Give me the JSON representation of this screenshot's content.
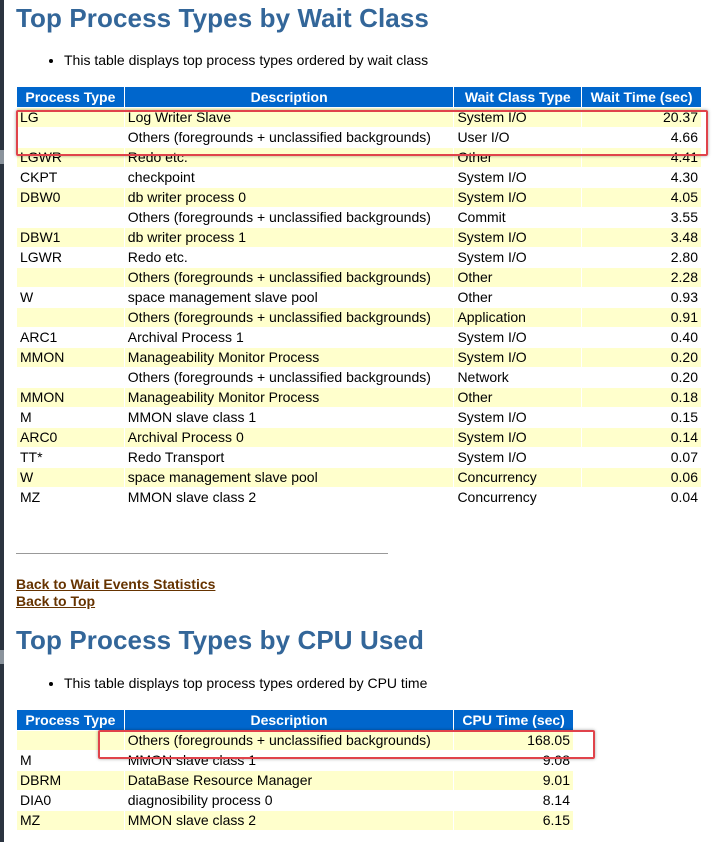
{
  "wait_section": {
    "title": "Top Process Types by Wait Class",
    "note": "This table displays top process types ordered by wait class",
    "columns": [
      "Process Type",
      "Description",
      "Wait Class Type",
      "Wait Time (sec)"
    ],
    "rows": [
      [
        "LG",
        "Log Writer Slave",
        "System I/O",
        "20.37"
      ],
      [
        "",
        "Others (foregrounds + unclassified backgrounds)",
        "User I/O",
        "4.66"
      ],
      [
        "LGWR",
        "Redo etc.",
        "Other",
        "4.41"
      ],
      [
        "CKPT",
        "checkpoint",
        "System I/O",
        "4.30"
      ],
      [
        "DBW0",
        "db writer process 0",
        "System I/O",
        "4.05"
      ],
      [
        "",
        "Others (foregrounds + unclassified backgrounds)",
        "Commit",
        "3.55"
      ],
      [
        "DBW1",
        "db writer process 1",
        "System I/O",
        "3.48"
      ],
      [
        "LGWR",
        "Redo etc.",
        "System I/O",
        "2.80"
      ],
      [
        "",
        "Others (foregrounds + unclassified backgrounds)",
        "Other",
        "2.28"
      ],
      [
        "W",
        "space management slave pool",
        "Other",
        "0.93"
      ],
      [
        "",
        "Others (foregrounds + unclassified backgrounds)",
        "Application",
        "0.91"
      ],
      [
        "ARC1",
        "Archival Process 1",
        "System I/O",
        "0.40"
      ],
      [
        "MMON",
        "Manageability Monitor Process",
        "System I/O",
        "0.20"
      ],
      [
        "",
        "Others (foregrounds + unclassified backgrounds)",
        "Network",
        "0.20"
      ],
      [
        "MMON",
        "Manageability Monitor Process",
        "Other",
        "0.18"
      ],
      [
        "M",
        "MMON slave class 1",
        "System I/O",
        "0.15"
      ],
      [
        "ARC0",
        "Archival Process 0",
        "System I/O",
        "0.14"
      ],
      [
        "TT*",
        "Redo Transport",
        "System I/O",
        "0.07"
      ],
      [
        "W",
        "space management slave pool",
        "Concurrency",
        "0.06"
      ],
      [
        "MZ",
        "MMON slave class 2",
        "Concurrency",
        "0.04"
      ]
    ]
  },
  "links": {
    "back_wait_events": "Back to Wait Events Statistics",
    "back_top": "Back to Top"
  },
  "cpu_section": {
    "title": "Top Process Types by CPU Used",
    "note": "This table displays top process types ordered by CPU time",
    "columns": [
      "Process Type",
      "Description",
      "CPU Time (sec)"
    ],
    "rows": [
      [
        "",
        "Others (foregrounds + unclassified backgrounds)",
        "168.05"
      ],
      [
        "M",
        "MMON slave class 1",
        "9.08"
      ],
      [
        "DBRM",
        "DataBase Resource Manager",
        "9.01"
      ],
      [
        "DIA0",
        "diagnosibility process 0",
        "8.14"
      ],
      [
        "MZ",
        "MMON slave class 2",
        "6.15"
      ]
    ]
  },
  "colors": {
    "heading": "#336699",
    "header_bg": "#0066cc",
    "row_odd": "#ffffcc",
    "row_even": "#ffffff",
    "link": "#663300",
    "highlight": "#e0434b"
  }
}
